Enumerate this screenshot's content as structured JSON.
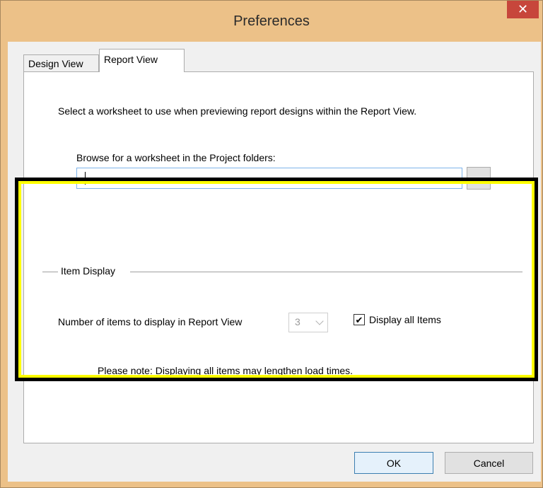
{
  "window": {
    "title": "Preferences",
    "close_glyph": "✕",
    "close_icon": "close-icon"
  },
  "tabs": [
    {
      "label": "Design View",
      "selected": false
    },
    {
      "label": "Report View",
      "selected": true
    }
  ],
  "report_view": {
    "intro_text": "Select a worksheet to use when previewing report designs within the Report View.",
    "browse_label": "Browse for a worksheet in the Project folders:",
    "path_value": "",
    "browse_button_label": "..."
  },
  "item_display": {
    "group_title": "Item Display",
    "count_label": "Number of items to display in Report View",
    "count_value": "3",
    "count_enabled": false,
    "display_all_checked": true,
    "display_all_label": "Display all Items",
    "note": "Please note: Displaying all items may lengthen load times."
  },
  "buttons": {
    "ok_label": "OK",
    "cancel_label": "Cancel"
  },
  "colors": {
    "title_bar": "#ecc188",
    "close_button": "#c7463b",
    "highlight_outer": "#000000",
    "highlight_inner": "#ffff00",
    "input_focus_border": "#7eb4ea"
  }
}
